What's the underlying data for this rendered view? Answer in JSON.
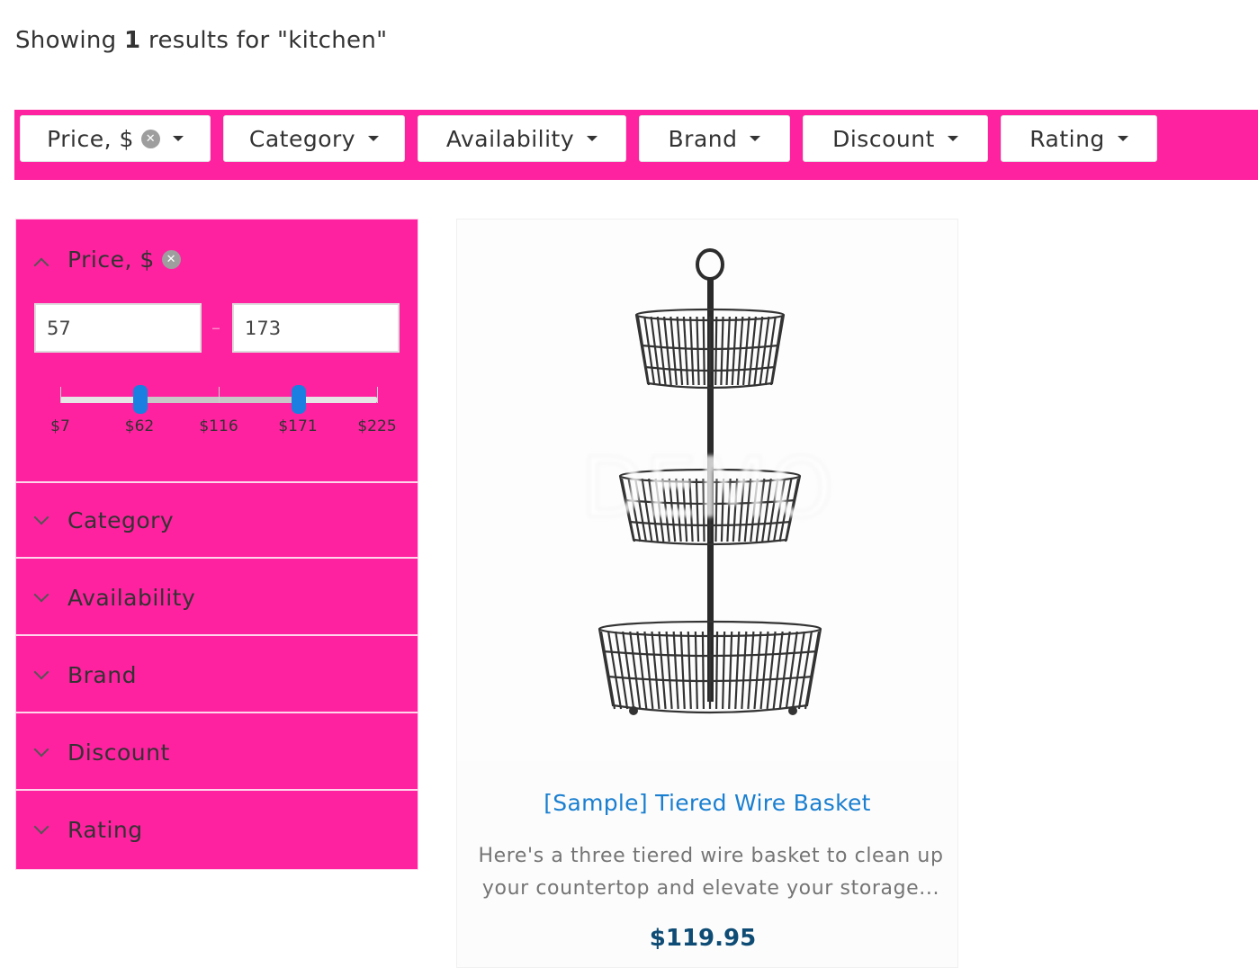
{
  "summary": {
    "prefix": "Showing",
    "count": "1",
    "suffix": "results for \"kitchen\""
  },
  "top_filters": [
    {
      "label": "Price, $",
      "has_clear": true
    },
    {
      "label": "Category",
      "has_clear": false
    },
    {
      "label": "Availability",
      "has_clear": false
    },
    {
      "label": "Brand",
      "has_clear": false
    },
    {
      "label": "Discount",
      "has_clear": false
    },
    {
      "label": "Rating",
      "has_clear": false
    }
  ],
  "price_facet": {
    "title": "Price, $",
    "min_value": "57",
    "max_value": "173",
    "scale_labels": [
      "$7",
      "$62",
      "$116",
      "$171",
      "$225"
    ],
    "scale_min": 7,
    "scale_max": 225,
    "handle_low": 62,
    "handle_high": 171
  },
  "facets": [
    {
      "label": "Category"
    },
    {
      "label": "Availability"
    },
    {
      "label": "Brand"
    },
    {
      "label": "Discount"
    },
    {
      "label": "Rating"
    }
  ],
  "product": {
    "name": "[Sample] Tiered Wire Basket",
    "description": "Here's a three tiered wire basket to clean up your countertop and elevate your storage...",
    "price": "$119.95",
    "watermark": "DEMO"
  },
  "colors": {
    "accent": "#ff22a0",
    "link": "#1a7fd0",
    "price": "#0f4c75",
    "slider_handle": "#1a7fe0"
  },
  "icons": {
    "clear": "close-circle-icon",
    "dropdown": "caret-down-icon",
    "expanded": "chevron-up-icon",
    "collapsed": "chevron-down-icon"
  }
}
